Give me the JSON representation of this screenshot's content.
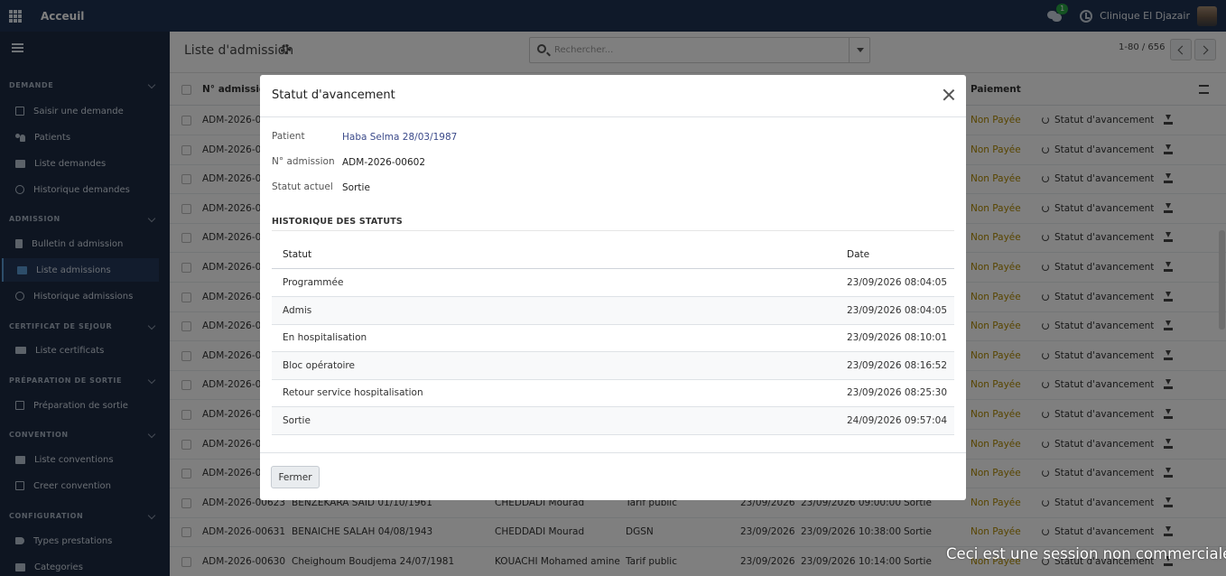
{
  "topbar": {
    "app_title": "Acceuil",
    "chat_badge": "1",
    "company": "Clinique El Djazair"
  },
  "sidebar": {
    "sections": [
      {
        "title": "DEMANDE",
        "items": [
          {
            "label": "Saisir une demande",
            "icon": "edit-icon"
          },
          {
            "label": "Patients",
            "icon": "users-icon"
          },
          {
            "label": "Liste demandes",
            "icon": "list-icon"
          },
          {
            "label": "Historique demandes",
            "icon": "history-icon"
          }
        ]
      },
      {
        "title": "ADMISSION",
        "items": [
          {
            "label": "Bulletin d admission",
            "icon": "document-icon"
          },
          {
            "label": "Liste admissions",
            "icon": "list-icon",
            "active": true
          },
          {
            "label": "Historique admissions",
            "icon": "history-icon"
          }
        ]
      },
      {
        "title": "CERTIFICAT DE SEJOUR",
        "items": [
          {
            "label": "Liste certificats",
            "icon": "id-card-icon"
          }
        ]
      },
      {
        "title": "PRÉPARATION DE SORTIE",
        "items": [
          {
            "label": "Préparation de sortie",
            "icon": "exit-icon"
          }
        ]
      },
      {
        "title": "CONVENTION",
        "items": [
          {
            "label": "Liste conventions",
            "icon": "list-icon"
          },
          {
            "label": "Creer convention",
            "icon": "plus-square-icon"
          }
        ]
      },
      {
        "title": "CONFIGURATION",
        "items": [
          {
            "label": "Types prestations",
            "icon": "tag-icon"
          },
          {
            "label": "Categories",
            "icon": "folder-icon"
          }
        ]
      }
    ]
  },
  "control": {
    "breadcrumb": "Liste d'admission",
    "search_placeholder": "Rechercher...",
    "pager": "1-80 / 656"
  },
  "list": {
    "headers": {
      "admission": "N° admission",
      "paiement": "Paiement"
    },
    "row_count_visible": 16,
    "payment_label": "Non Payée",
    "statut_label": "Statut d'avancement",
    "row_prefix": "ADM-2026-0",
    "partial_row": {
      "admission": "ADM-2026-00623",
      "patient": "BENZEKARA SAID 01/10/1961",
      "doctor": "CHEDDADI Mourad",
      "convention": "Tarif public",
      "date": "23/09/2026",
      "datetime": "23/09/2026 09:00:00",
      "statut": "Sortie"
    },
    "bottom_rows": [
      {
        "admission": "ADM-2026-00631",
        "patient": "BENAICHE SALAH 04/08/1943",
        "doctor": "CHEDDADI Mourad",
        "convention": "DGSN",
        "date": "23/09/2026",
        "datetime": "23/09/2026 10:38:00",
        "statut": "Sortie"
      },
      {
        "admission": "ADM-2026-00630",
        "patient": "Cheighoum Boudjema 24/07/1981",
        "doctor": "KOUACHI Mohamed amine",
        "convention": "Tarif public",
        "date": "23/09/2026",
        "datetime": "23/09/2026 10:14:00",
        "statut": "Sortie"
      }
    ]
  },
  "modal": {
    "title": "Statut d'avancement",
    "patient_label": "Patient",
    "patient_value": "Haba Selma 28/03/1987",
    "admission_label": "N° admission",
    "admission_value": "ADM-2026-00602",
    "statut_label": "Statut actuel",
    "statut_value": "Sortie",
    "history_title": "HISTORIQUE DES STATUTS",
    "history_headers": {
      "statut": "Statut",
      "date": "Date"
    },
    "history": [
      {
        "statut": "Programmée",
        "date": "23/09/2026 08:04:05"
      },
      {
        "statut": "Admis",
        "date": "23/09/2026 08:04:05"
      },
      {
        "statut": "En hospitalisation",
        "date": "23/09/2026 08:10:01"
      },
      {
        "statut": "Bloc opératoire",
        "date": "23/09/2026 08:16:52"
      },
      {
        "statut": "Retour service hospitalisation",
        "date": "23/09/2026 08:25:30"
      },
      {
        "statut": "Sortie",
        "date": "24/09/2026 09:57:04"
      }
    ],
    "close_button": "Fermer"
  },
  "watermark": "Ceci est une session non commerciale."
}
